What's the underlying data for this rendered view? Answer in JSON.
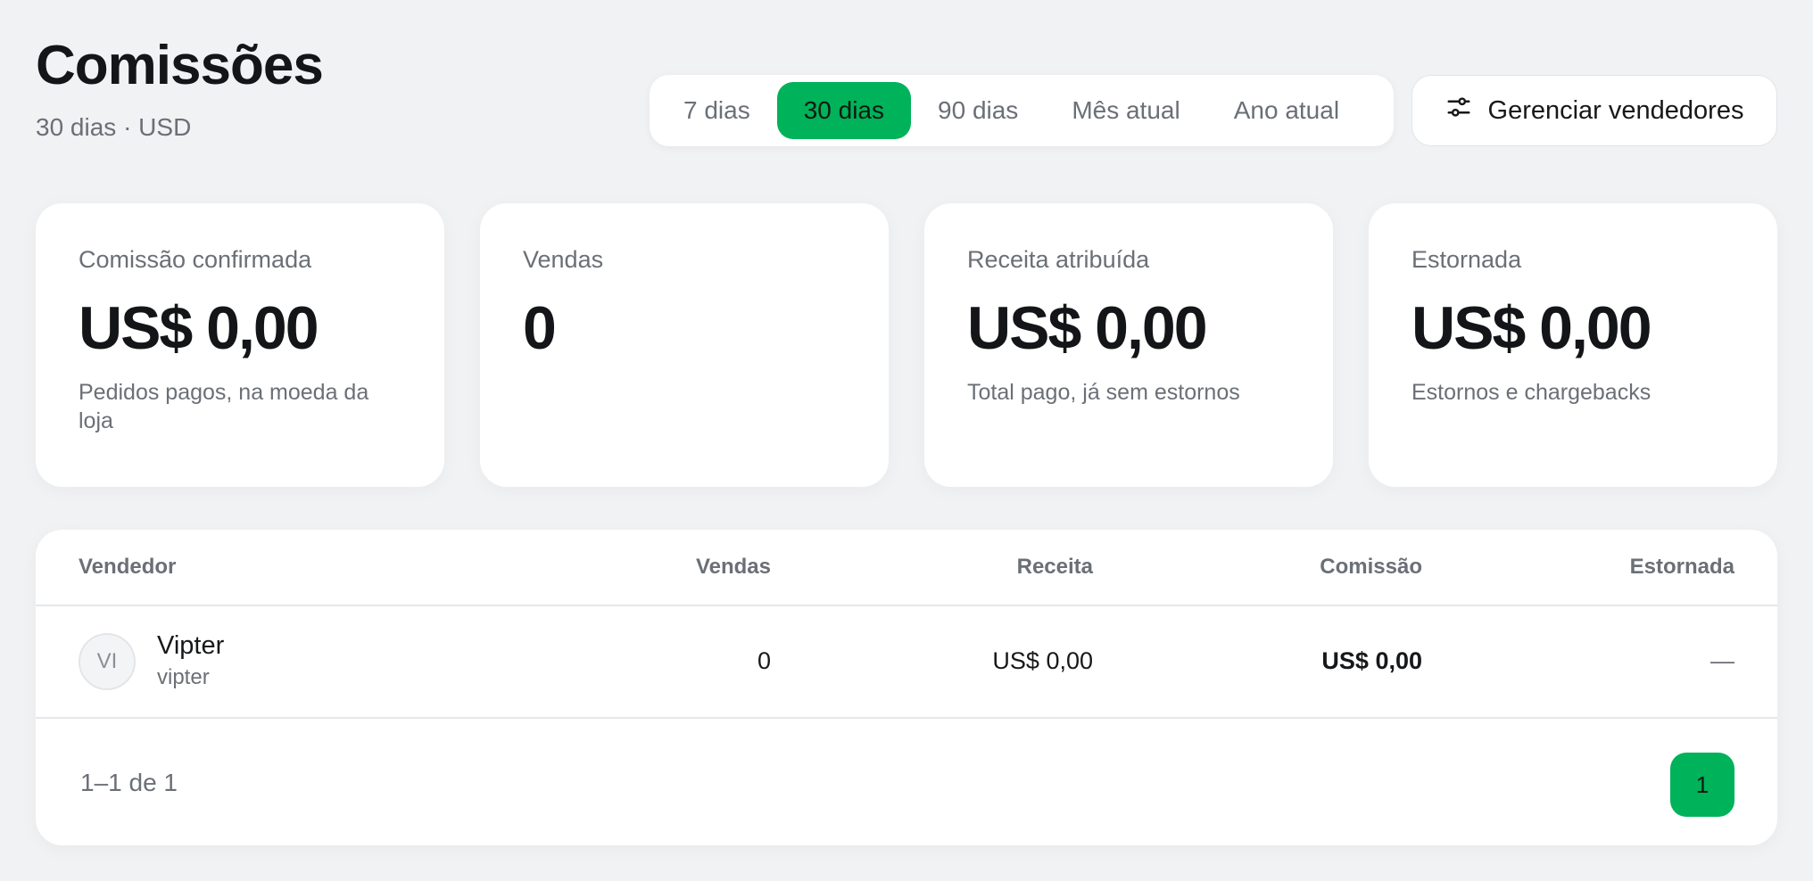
{
  "header": {
    "title": "Comissões",
    "subtitle": "30 dias · USD"
  },
  "range_filter": {
    "options": [
      "7 dias",
      "30 dias",
      "90 dias",
      "Mês atual",
      "Ano atual"
    ],
    "selected": "30 dias"
  },
  "actions": {
    "manage_label": "Gerenciar vendedores",
    "manage_icon": "sliders-icon"
  },
  "stats": [
    {
      "label": "Comissão confirmada",
      "value": "US$ 0,00",
      "note": "Pedidos pagos, na moeda da loja"
    },
    {
      "label": "Vendas",
      "value": "0",
      "note": ""
    },
    {
      "label": "Receita atribuída",
      "value": "US$ 0,00",
      "note": "Total pago, já sem estornos"
    },
    {
      "label": "Estornada",
      "value": "US$ 0,00",
      "note": "Estornos e chargebacks"
    }
  ],
  "table": {
    "columns": [
      "Vendedor",
      "Vendas",
      "Receita",
      "Comissão",
      "Estornada"
    ],
    "rows": [
      {
        "initials": "VI",
        "name": "Vipter",
        "handle": "vipter",
        "sales": "0",
        "revenue": "US$ 0,00",
        "commission": "US$ 0,00",
        "refunded": "—"
      }
    ],
    "range_text": "1–1 de 1",
    "current_page": "1"
  },
  "colors": {
    "accent": "#00b259",
    "background": "#f1f2f4",
    "card": "#ffffff",
    "muted_text": "#6b6f76"
  }
}
